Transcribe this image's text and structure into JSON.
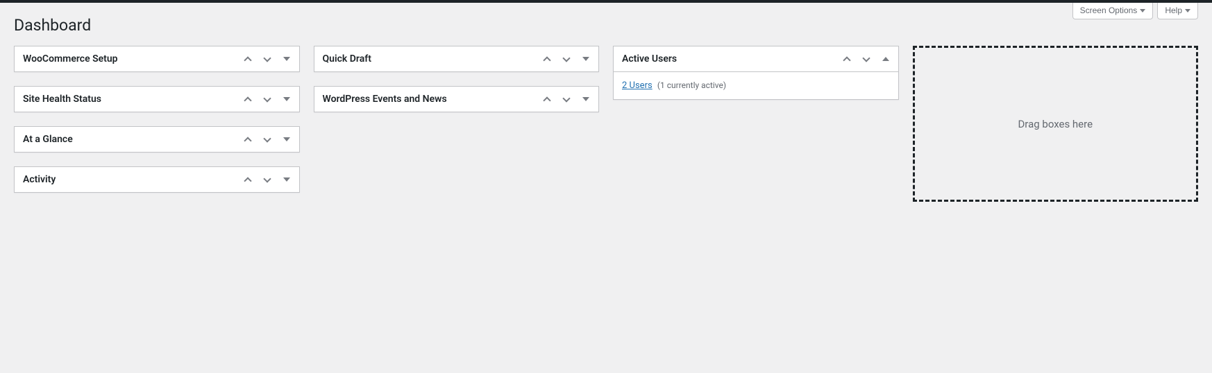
{
  "screen_meta": {
    "screen_options": "Screen Options",
    "help": "Help"
  },
  "page_title": "Dashboard",
  "columns": {
    "col1": [
      {
        "id": "woocommerce-setup",
        "title": "WooCommerce Setup",
        "open": false
      },
      {
        "id": "site-health-status",
        "title": "Site Health Status",
        "open": false
      },
      {
        "id": "at-a-glance",
        "title": "At a Glance",
        "open": false
      },
      {
        "id": "activity",
        "title": "Activity",
        "open": false
      }
    ],
    "col2": [
      {
        "id": "quick-draft",
        "title": "Quick Draft",
        "open": false
      },
      {
        "id": "wp-events-news",
        "title": "WordPress Events and News",
        "open": false
      }
    ],
    "col3": [
      {
        "id": "active-users",
        "title": "Active Users",
        "open": true
      }
    ]
  },
  "active_users": {
    "link_text": "2 Users",
    "detail": "(1 currently active)"
  },
  "drop_target": {
    "label": "Drag boxes here"
  }
}
